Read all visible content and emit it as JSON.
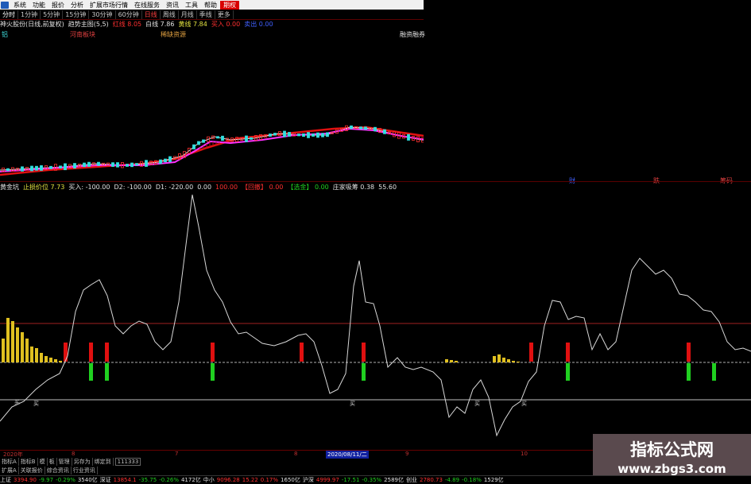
{
  "menu": [
    "系统",
    "功能",
    "报价",
    "分析",
    "扩展市场行情",
    "在线服务",
    "资讯",
    "工具",
    "帮助",
    "期权"
  ],
  "periods": [
    "分时",
    "1分钟",
    "5分钟",
    "15分钟",
    "30分钟",
    "60分钟",
    "日线",
    "周线",
    "月线",
    "季线",
    "更多"
  ],
  "info": {
    "stock": "神火股份(日线,前复权)",
    "indicator": "趋势主图(5,5)",
    "red_line": "红线 8.05",
    "white_line": "白线 7.86",
    "yellow_line": "黄线 7.84",
    "buy": "买入 0.00",
    "sell": "卖出 0.00",
    "tag_left": "铝",
    "tag_henan": "河南板块",
    "tag_zy": "稀缺资源",
    "tag_rz": "融资融券"
  },
  "signals": {
    "cai": "财",
    "xie": "跌",
    "hui": "筹码"
  },
  "ind": {
    "name": "黄金坑",
    "zhisun": "止损价位 7.73",
    "buy": "买入: -100.00",
    "d2": "D2: -100.00",
    "d1": "D1: -220.00",
    "v1": "0.00",
    "v2": "100.00",
    "shou": "【回撤】 0.00",
    "xian": "【选金】 0.00",
    "zhuangjia": "庄家吸筹 0.38",
    "val": "55.60"
  },
  "mai_label": "买",
  "time_labels": [
    "2020年",
    "8",
    "7",
    "8",
    "2020/08/11/二",
    "9",
    "10"
  ],
  "tabs": [
    "指标A",
    "指标B",
    "模",
    "板",
    "管理",
    "另存为",
    "绑定到",
    "111333"
  ],
  "tabs2": [
    "扩展A",
    "关联报价",
    "综合资讯",
    "行业资讯"
  ],
  "status": [
    {
      "t": "上证",
      "c": "wh"
    },
    {
      "t": "3394.90",
      "c": "up"
    },
    {
      "t": "-9.97",
      "c": "dn"
    },
    {
      "t": "-0.29%",
      "c": "dn"
    },
    {
      "t": "3540亿",
      "c": "wh"
    },
    {
      "t": "深证",
      "c": "wh"
    },
    {
      "t": "13854.1",
      "c": "up"
    },
    {
      "t": "-35.75",
      "c": "dn"
    },
    {
      "t": "-0.26%",
      "c": "dn"
    },
    {
      "t": "4172亿",
      "c": "wh"
    },
    {
      "t": "中小",
      "c": "wh"
    },
    {
      "t": "9096.28",
      "c": "up"
    },
    {
      "t": "15.22",
      "c": "up"
    },
    {
      "t": "0.17%",
      "c": "up"
    },
    {
      "t": "1650亿",
      "c": "wh"
    },
    {
      "t": "沪深",
      "c": "wh"
    },
    {
      "t": "4999.97",
      "c": "up"
    },
    {
      "t": "-17.51",
      "c": "dn"
    },
    {
      "t": "-0.35%",
      "c": "dn"
    },
    {
      "t": "2589亿",
      "c": "wh"
    },
    {
      "t": "创业",
      "c": "wh"
    },
    {
      "t": "2780.73",
      "c": "up"
    },
    {
      "t": "-4.89",
      "c": "dn"
    },
    {
      "t": "-0.18%",
      "c": "dn"
    },
    {
      "t": "1529亿",
      "c": "wh"
    }
  ],
  "watermark": {
    "line1": "指标公式网",
    "line2": "www.zbgs3.com"
  }
}
